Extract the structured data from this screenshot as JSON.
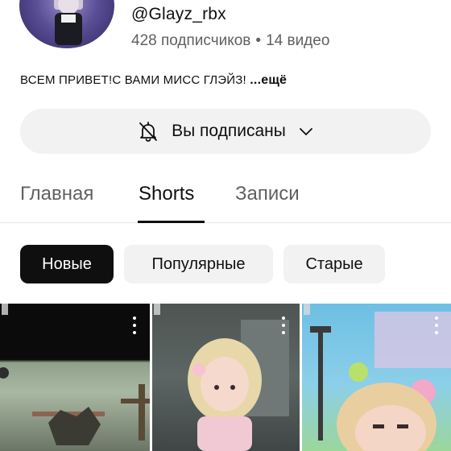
{
  "channel": {
    "handle": "@Glayz_rbx",
    "subscribers": "428 подписчиков",
    "separator": "•",
    "videos": "14 видео",
    "description": "ВСЕМ ПРИВЕТ!С ВАМИ МИСС ГЛЭЙЗ!",
    "more": "...ещё"
  },
  "subscribe": {
    "label": "Вы подписаны",
    "bell_icon": "bell-off-icon",
    "chevron_icon": "chevron-down-icon"
  },
  "tabs": [
    {
      "label": "Главная",
      "active": false
    },
    {
      "label": "Shorts",
      "active": true
    },
    {
      "label": "Записи",
      "active": false
    }
  ],
  "filters": [
    {
      "label": "Новые",
      "selected": true
    },
    {
      "label": "Популярные",
      "selected": false
    },
    {
      "label": "Старые",
      "selected": false
    }
  ],
  "shorts": [
    {
      "thumbnail": "roblox-scene-dark",
      "menu_icon": "more-vert-icon"
    },
    {
      "thumbnail": "roblox-avatar-blonde",
      "menu_icon": "more-vert-icon"
    },
    {
      "thumbnail": "roblox-avatar-outdoor",
      "menu_icon": "more-vert-icon"
    }
  ],
  "colors": {
    "text": "#0f0f0f",
    "secondary_text": "#606060",
    "chip_selected_bg": "#0f0f0f",
    "chip_bg": "#f2f2f2"
  }
}
